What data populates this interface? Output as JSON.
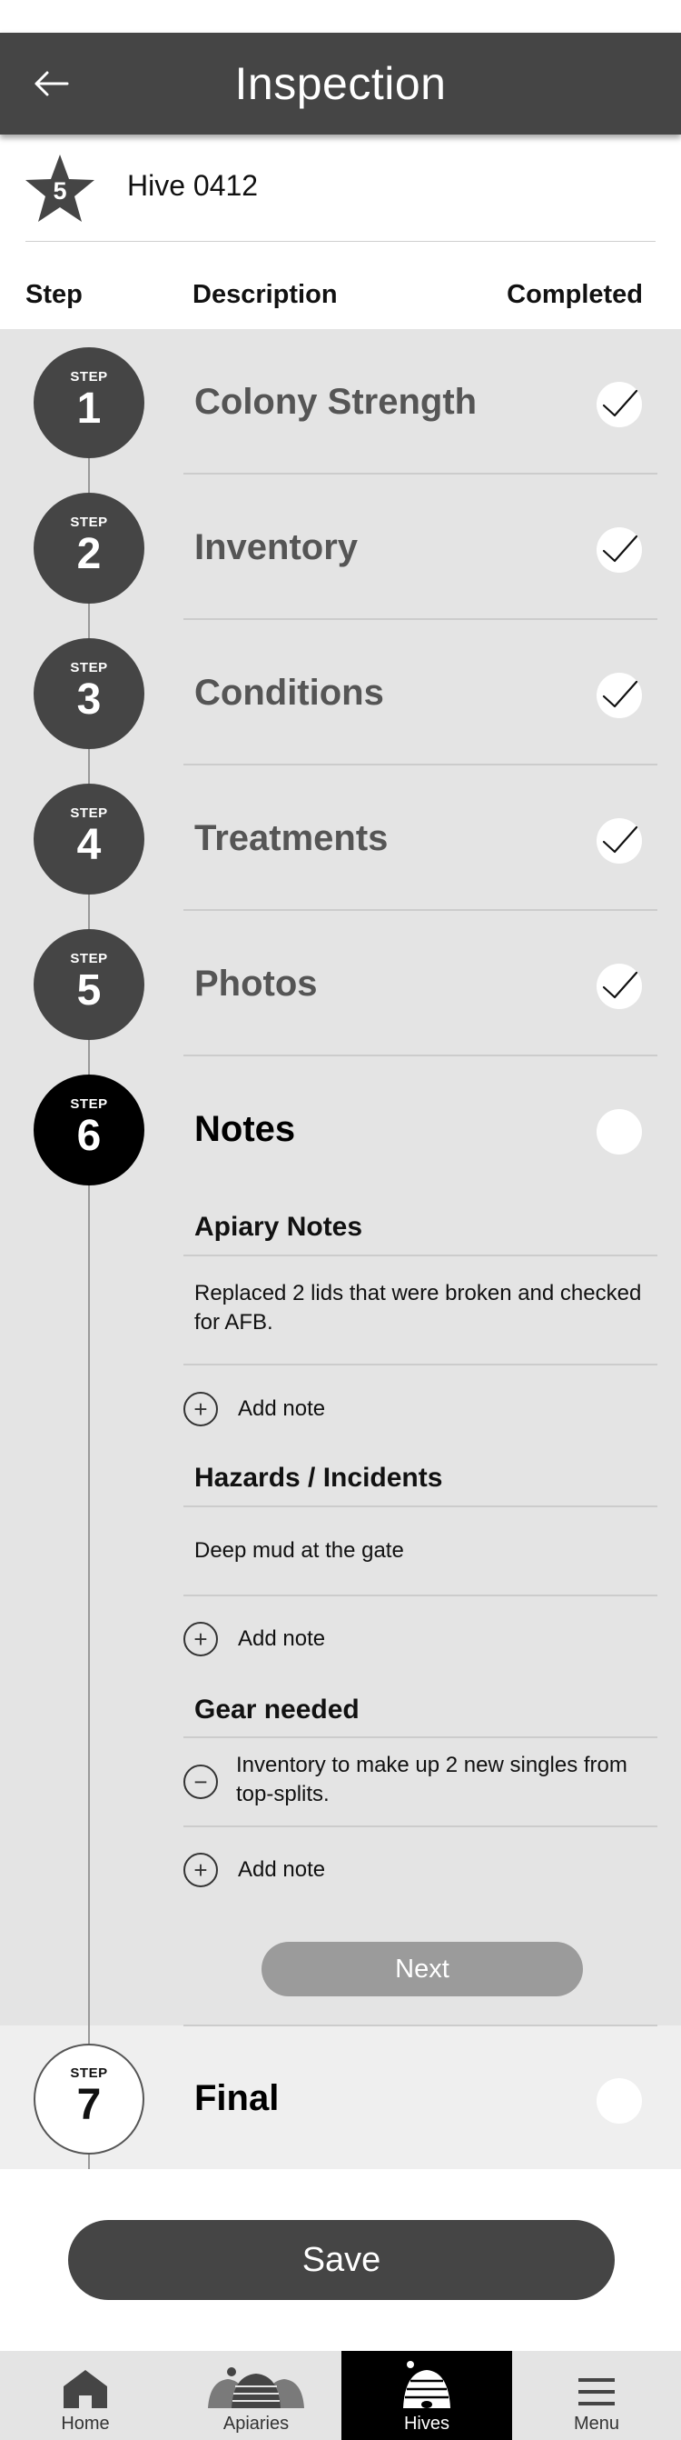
{
  "header": {
    "title": "Inspection",
    "back_icon": "arrow-left-icon"
  },
  "hive": {
    "badge_number": "5",
    "name": "Hive 0412"
  },
  "columns": {
    "step": "Step",
    "description": "Description",
    "completed": "Completed"
  },
  "steps": [
    {
      "word": "STEP",
      "number": "1",
      "title": "Colony Strength",
      "completed": true
    },
    {
      "word": "STEP",
      "number": "2",
      "title": "Inventory",
      "completed": true
    },
    {
      "word": "STEP",
      "number": "3",
      "title": "Conditions",
      "completed": true
    },
    {
      "word": "STEP",
      "number": "4",
      "title": "Treatments",
      "completed": true
    },
    {
      "word": "STEP",
      "number": "5",
      "title": "Photos",
      "completed": true
    },
    {
      "word": "STEP",
      "number": "6",
      "title": "Notes",
      "completed": false
    },
    {
      "word": "STEP",
      "number": "7",
      "title": "Final",
      "completed": false
    }
  ],
  "notes": {
    "apiary": {
      "title": "Apiary Notes",
      "text": "Replaced 2 lids that were broken and checked for AFB.",
      "add_label": "Add note"
    },
    "hazards": {
      "title": "Hazards / Incidents",
      "text": "Deep mud at the gate",
      "add_label": "Add note"
    },
    "gear": {
      "title": "Gear needed",
      "text": "Inventory to make up 2 new singles from top-splits.",
      "add_label": "Add note"
    },
    "next_label": "Next"
  },
  "save_label": "Save",
  "nav": {
    "home": "Home",
    "apiaries": "Apiaries",
    "hives": "Hives",
    "menu": "Menu",
    "active": "hives"
  },
  "colors": {
    "header_bg": "#454545",
    "steps_bg": "#e4e4e4",
    "active_step": "#000000",
    "next_button": "#9b9b9b"
  }
}
